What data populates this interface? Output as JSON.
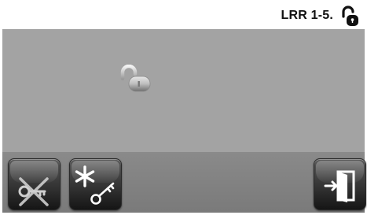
{
  "header": {
    "title": "LRR 1-5.",
    "status_icon": "padlock-open-icon"
  },
  "main": {
    "icon": "padlock-open-icon"
  },
  "footer": {
    "buttons": [
      {
        "icon": "key-crossed-out-icon"
      },
      {
        "icon": "asterisk-key-icon"
      },
      {
        "icon": "exit-door-icon"
      }
    ]
  },
  "colors": {
    "header_bg": "#ffffff",
    "main_bg": "#a3a3a3",
    "footer_bg": "#808080",
    "button_bg": "#2a2a2a"
  }
}
